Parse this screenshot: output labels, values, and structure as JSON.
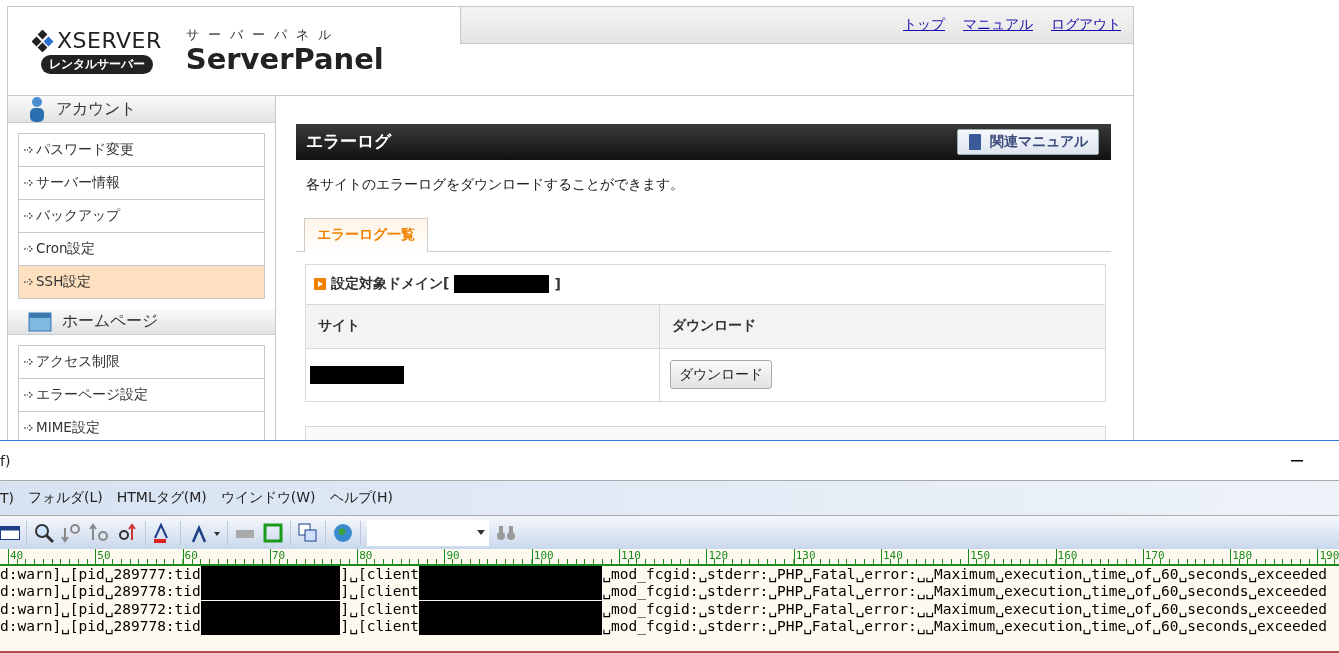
{
  "header": {
    "brand": "XSERVER",
    "badge": "レンタルサーバー",
    "kana": "サーバーパネル",
    "product": "ServerPanel",
    "nav": [
      "トップ",
      "マニュアル",
      "ログアウト"
    ]
  },
  "sidebar": {
    "sections": [
      {
        "title": "アカウント",
        "items": [
          {
            "label": "パスワード変更",
            "selected": false
          },
          {
            "label": "サーバー情報",
            "selected": false
          },
          {
            "label": "バックアップ",
            "selected": false
          },
          {
            "label": "Cron設定",
            "selected": false
          },
          {
            "label": "SSH設定",
            "selected": true
          }
        ]
      },
      {
        "title": "ホームページ",
        "items": [
          {
            "label": "アクセス制限",
            "selected": false
          },
          {
            "label": "エラーページ設定",
            "selected": false
          },
          {
            "label": "MIME設定",
            "selected": false
          }
        ]
      }
    ]
  },
  "main": {
    "title": "エラーログ",
    "manual_button": "関連マニュアル",
    "description": "各サイトのエラーログをダウンロードすることができます。",
    "tabs": [
      {
        "label": "エラーログ一覧",
        "selected": true
      }
    ],
    "panel": {
      "heading": "設定対象ドメイン[",
      "heading_end": "]",
      "columns": [
        "サイト",
        "ダウンロード"
      ],
      "rows": [
        {
          "download": "ダウンロード"
        }
      ]
    }
  },
  "editor": {
    "title": "f)",
    "menus": [
      "T)",
      "フォルダ(L)",
      "HTMLタグ(M)",
      "ウインドウ(W)",
      "ヘルプ(H)"
    ],
    "ruler": [
      "40",
      "50",
      "60",
      "70",
      "80",
      "90",
      "100",
      "110",
      "120",
      "130",
      "140",
      "150",
      "160",
      "170",
      "180",
      "190"
    ],
    "lines": [
      {
        "head": "d:warn]␣[pid␣289777:tid",
        "mid": "]␣[client",
        "tail": "␣mod_fcgid:␣stderr:␣PHP␣Fatal␣error:␣␣Maximum␣execution␣time␣of␣60␣seconds␣exceeded"
      },
      {
        "head": "d:warn]␣[pid␣289778:tid",
        "mid": "]␣[client",
        "tail": "␣mod_fcgid:␣stderr:␣PHP␣Fatal␣error:␣␣Maximum␣execution␣time␣of␣60␣seconds␣exceeded"
      },
      {
        "head": "d:warn]␣[pid␣289772:tid",
        "mid": "]␣[client",
        "tail": "␣mod_fcgid:␣stderr:␣PHP␣Fatal␣error:␣␣Maximum␣execution␣time␣of␣60␣seconds␣exceeded"
      },
      {
        "head": "d:warn]␣[pid␣289778:tid",
        "mid": "]␣[client",
        "tail": "␣mod_fcgid:␣stderr:␣PHP␣Fatal␣error:␣␣Maximum␣execution␣time␣of␣60␣seconds␣exceeded"
      }
    ]
  }
}
